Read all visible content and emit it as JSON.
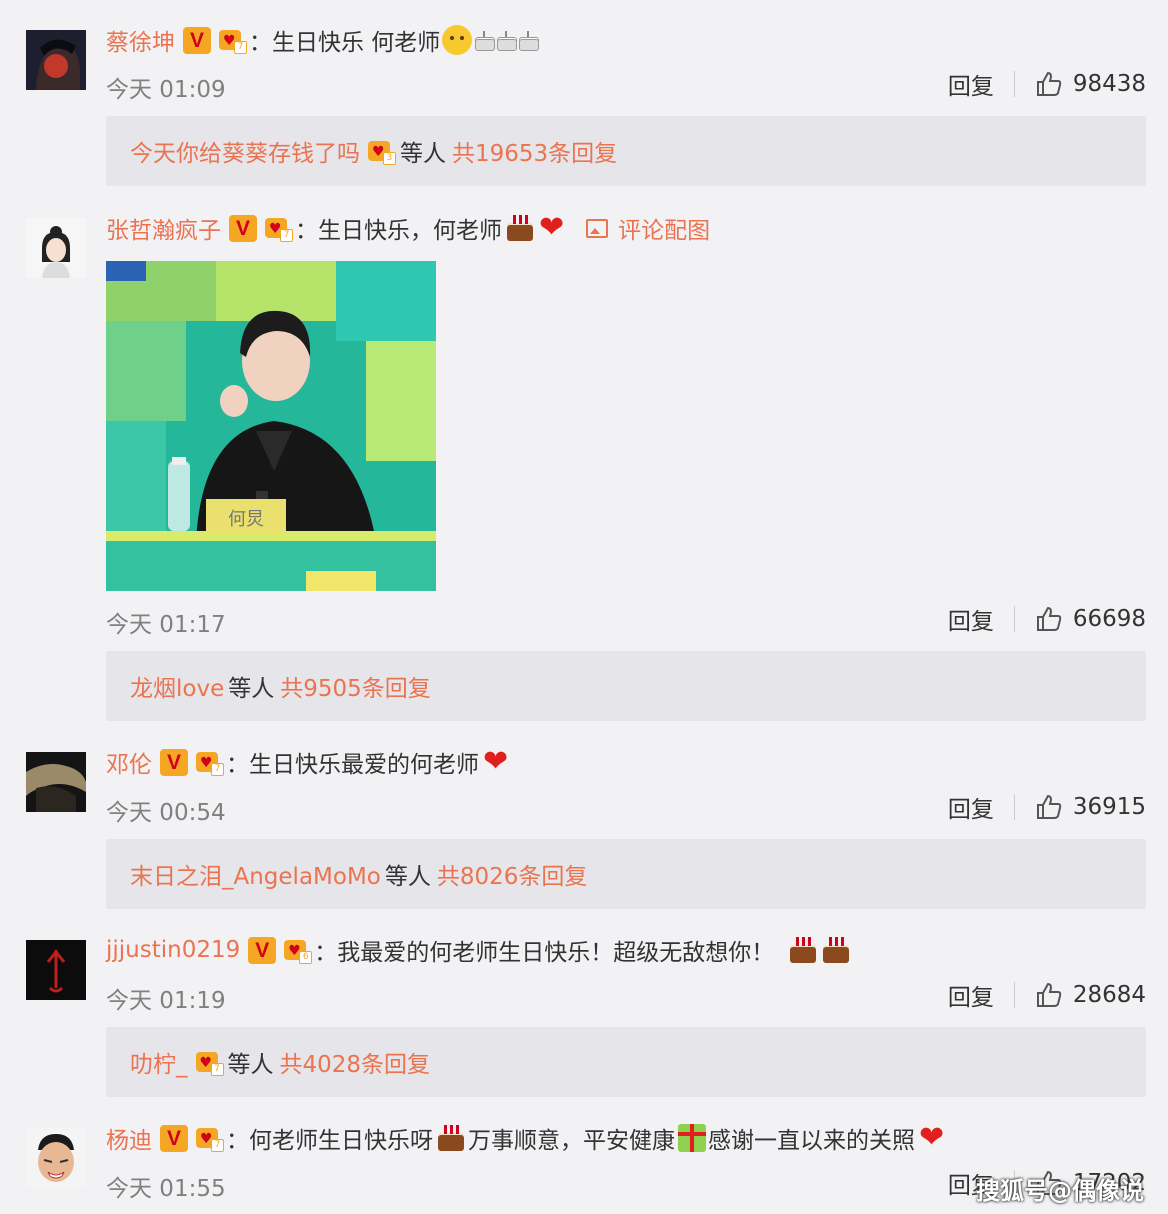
{
  "comments": [
    {
      "user": "蔡徐坤",
      "crown_level": "7",
      "text": "：生日快乐 何老师",
      "time": "今天 01:09",
      "reply_label": "回复",
      "likes": "98438",
      "reply_preview": {
        "names": "今天你给葵葵存钱了吗",
        "crown_level": "3",
        "mid": "等人",
        "count": "共19653条回复"
      }
    },
    {
      "user": "张哲瀚疯子",
      "crown_level": "7",
      "text": "：生日快乐，何老师",
      "image_link": "评论配图",
      "photo_caption": "何炅",
      "time": "今天 01:17",
      "reply_label": "回复",
      "likes": "66698",
      "reply_preview": {
        "names": "龙烟love",
        "mid": "等人",
        "count": "共9505条回复"
      }
    },
    {
      "user": "邓伦",
      "crown_level": "7",
      "text": "：生日快乐最爱的何老师",
      "time": "今天 00:54",
      "reply_label": "回复",
      "likes": "36915",
      "reply_preview": {
        "names": "末日之泪_AngelaMoMo",
        "mid": "等人",
        "count": "共8026条回复"
      }
    },
    {
      "user": "jjjustin0219",
      "crown_level": "6",
      "text": "：我最爱的何老师生日快乐！超级无敌想你！",
      "time": "今天 01:19",
      "reply_label": "回复",
      "likes": "28684",
      "reply_preview": {
        "names": "叻柠_",
        "crown_level": "7",
        "mid": "等人",
        "count": "共4028条回复"
      }
    },
    {
      "user": "杨迪",
      "crown_level": "7",
      "text_a": "：何老师生日快乐呀",
      "text_b": "万事顺意，平安健康",
      "text_c": "感谢一直以来的关照",
      "time": "今天 01:55",
      "reply_label": "回复",
      "likes": "17202"
    }
  ],
  "watermark": "搜狐号@偶像说",
  "colors": {
    "accent": "#eb7350",
    "background": "#f2f2f5",
    "reply_box": "#e6e6ea"
  }
}
